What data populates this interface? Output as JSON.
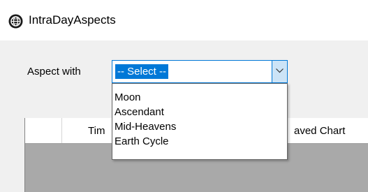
{
  "window": {
    "title": "IntraDayAspects",
    "icon": "app-globe-icon"
  },
  "form": {
    "aspect_label": "Aspect with",
    "combo": {
      "selected": "-- Select --",
      "options": [
        "Moon",
        "Ascendant",
        "Mid-Heavens",
        "Earth Cycle"
      ],
      "expanded": true
    }
  },
  "grid": {
    "columns": [
      "",
      "Tim",
      "aved Chart"
    ]
  },
  "colors": {
    "accent": "#0078d7",
    "grid_body": "#a9a9a9",
    "client_bg": "#f0f0f0"
  }
}
